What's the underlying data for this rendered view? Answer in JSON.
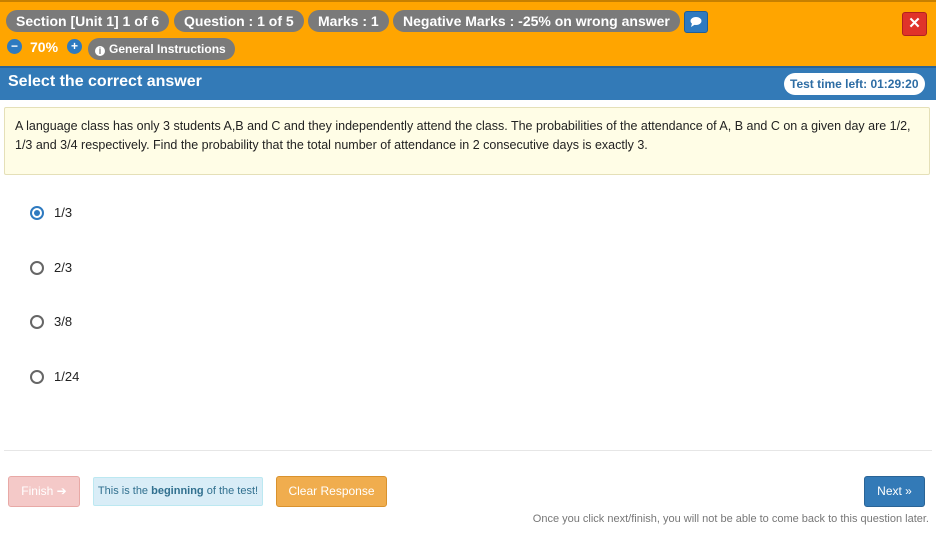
{
  "header": {
    "section": "Section [Unit 1] 1 of 6",
    "question_counter": "Question : 1 of 5",
    "marks": "Marks : 1",
    "negative_marks": "Negative Marks : -25% on wrong answer",
    "zoom_level": "70%",
    "zoom_minus": "−",
    "zoom_plus": "+",
    "close_label": "✕",
    "general_instructions": "General Instructions",
    "info_glyph": "i"
  },
  "question_bar": {
    "heading": "Select the correct answer",
    "timer": "Test time left: 01:29:20"
  },
  "question": {
    "text": "A language class has only 3 students A,B and C and they independently attend the class. The probabilities of the attendance of A, B and C on a given day are 1/2, 1/3 and 3/4 respectively. Find the probability that the total number of attendance in 2 consecutive days is exactly 3."
  },
  "options": [
    {
      "label": "1/3",
      "selected": true
    },
    {
      "label": "2/3",
      "selected": false
    },
    {
      "label": "3/8",
      "selected": false
    },
    {
      "label": "1/24",
      "selected": false
    }
  ],
  "footer": {
    "finish_label": "Finish ➔",
    "beginning_note_pre": "This is the ",
    "beginning_note_bold": "beginning",
    "beginning_note_post": " of the test!",
    "clear_label": "Clear Response",
    "next_label": "Next »",
    "footnote": "Once you click next/finish, you will not be able to come back to this question later."
  },
  "icons": {
    "chat": "comment-icon",
    "close": "close-icon",
    "info": "info-icon"
  },
  "colors": {
    "header_bg": "#ffa500",
    "title_bar_bg": "#337ab7",
    "close_bg": "#e0332a",
    "clear_bg": "#f0ad4e",
    "next_bg": "#337ab7"
  }
}
